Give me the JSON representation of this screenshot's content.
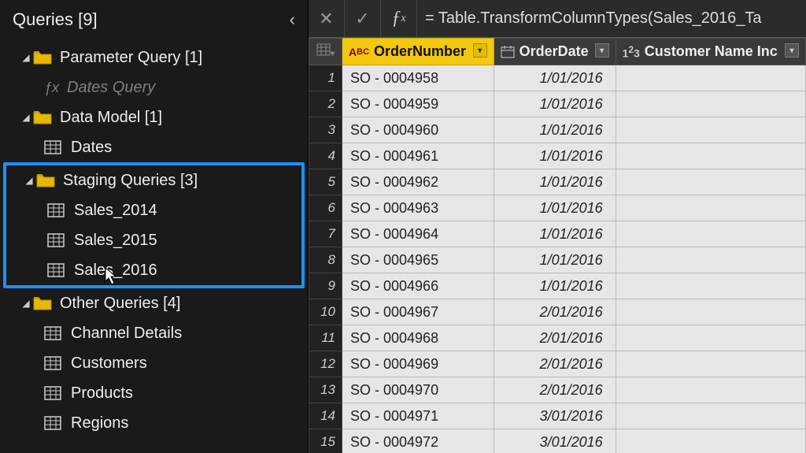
{
  "sidebar": {
    "title": "Queries [9]",
    "groups": [
      {
        "label": "Parameter Query [1]",
        "children": [
          {
            "label": "Dates Query",
            "type": "fx",
            "dim": true
          }
        ]
      },
      {
        "label": "Data Model [1]",
        "children": [
          {
            "label": "Dates",
            "type": "table"
          }
        ]
      },
      {
        "label": "Staging Queries [3]",
        "highlighted": true,
        "children": [
          {
            "label": "Sales_2014",
            "type": "table"
          },
          {
            "label": "Sales_2015",
            "type": "table"
          },
          {
            "label": "Sales_2016",
            "type": "table"
          }
        ]
      },
      {
        "label": "Other Queries [4]",
        "children": [
          {
            "label": "Channel Details",
            "type": "table"
          },
          {
            "label": "Customers",
            "type": "table"
          },
          {
            "label": "Products",
            "type": "table"
          },
          {
            "label": "Regions",
            "type": "table"
          }
        ]
      }
    ]
  },
  "formula": "= Table.TransformColumnTypes(Sales_2016_Ta",
  "columns": [
    {
      "name": "OrderNumber",
      "type": "text",
      "selected": true
    },
    {
      "name": "OrderDate",
      "type": "date"
    },
    {
      "name": "Customer Name Inc",
      "type": "number"
    }
  ],
  "rows": [
    {
      "n": 1,
      "order": "SO - 0004958",
      "date": "1/01/2016"
    },
    {
      "n": 2,
      "order": "SO - 0004959",
      "date": "1/01/2016"
    },
    {
      "n": 3,
      "order": "SO - 0004960",
      "date": "1/01/2016"
    },
    {
      "n": 4,
      "order": "SO - 0004961",
      "date": "1/01/2016"
    },
    {
      "n": 5,
      "order": "SO - 0004962",
      "date": "1/01/2016"
    },
    {
      "n": 6,
      "order": "SO - 0004963",
      "date": "1/01/2016"
    },
    {
      "n": 7,
      "order": "SO - 0004964",
      "date": "1/01/2016"
    },
    {
      "n": 8,
      "order": "SO - 0004965",
      "date": "1/01/2016"
    },
    {
      "n": 9,
      "order": "SO - 0004966",
      "date": "1/01/2016"
    },
    {
      "n": 10,
      "order": "SO - 0004967",
      "date": "2/01/2016"
    },
    {
      "n": 11,
      "order": "SO - 0004968",
      "date": "2/01/2016"
    },
    {
      "n": 12,
      "order": "SO - 0004969",
      "date": "2/01/2016"
    },
    {
      "n": 13,
      "order": "SO - 0004970",
      "date": "2/01/2016"
    },
    {
      "n": 14,
      "order": "SO - 0004971",
      "date": "3/01/2016"
    },
    {
      "n": 15,
      "order": "SO - 0004972",
      "date": "3/01/2016"
    }
  ]
}
